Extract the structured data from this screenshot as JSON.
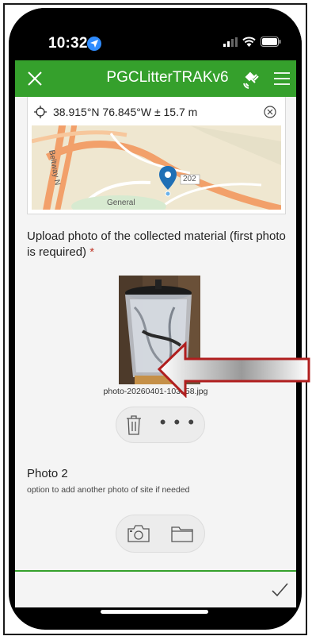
{
  "status": {
    "time": "10:32"
  },
  "app": {
    "title": "PGCLitterTRAKv6"
  },
  "location": {
    "coordinates": "38.915°N 76.845°W ± 15.7 m"
  },
  "map": {
    "road_label_left": "Beltway N",
    "road_label_right": "202",
    "place_label": "General"
  },
  "upload": {
    "label": "Upload photo of the collected material (first photo is required)",
    "required_mark": "*",
    "filename": "photo-20260401-103158.jpg",
    "more_label": "• • •"
  },
  "photo2": {
    "title": "Photo 2",
    "hint": "option to add another photo of site if needed"
  },
  "colors": {
    "accent": "#35a02c",
    "required": "#c0392b",
    "annotation_arrow": "#b01e1e"
  }
}
